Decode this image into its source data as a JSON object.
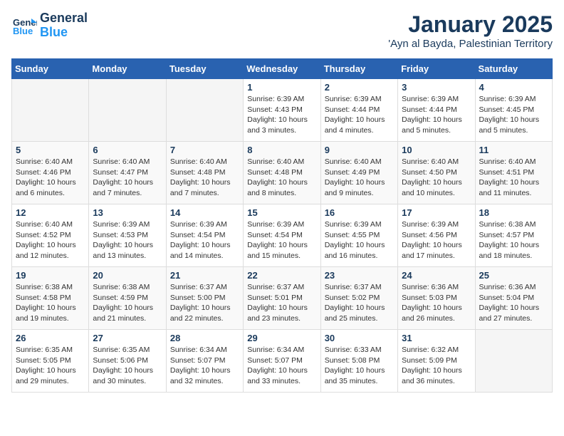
{
  "header": {
    "logo_line1": "General",
    "logo_line2": "Blue",
    "month_title": "January 2025",
    "location": "'Ayn al Bayda, Palestinian Territory"
  },
  "weekdays": [
    "Sunday",
    "Monday",
    "Tuesday",
    "Wednesday",
    "Thursday",
    "Friday",
    "Saturday"
  ],
  "weeks": [
    [
      {
        "day": "",
        "info": ""
      },
      {
        "day": "",
        "info": ""
      },
      {
        "day": "",
        "info": ""
      },
      {
        "day": "1",
        "info": "Sunrise: 6:39 AM\nSunset: 4:43 PM\nDaylight: 10 hours and 3 minutes."
      },
      {
        "day": "2",
        "info": "Sunrise: 6:39 AM\nSunset: 4:44 PM\nDaylight: 10 hours and 4 minutes."
      },
      {
        "day": "3",
        "info": "Sunrise: 6:39 AM\nSunset: 4:44 PM\nDaylight: 10 hours and 5 minutes."
      },
      {
        "day": "4",
        "info": "Sunrise: 6:39 AM\nSunset: 4:45 PM\nDaylight: 10 hours and 5 minutes."
      }
    ],
    [
      {
        "day": "5",
        "info": "Sunrise: 6:40 AM\nSunset: 4:46 PM\nDaylight: 10 hours and 6 minutes."
      },
      {
        "day": "6",
        "info": "Sunrise: 6:40 AM\nSunset: 4:47 PM\nDaylight: 10 hours and 7 minutes."
      },
      {
        "day": "7",
        "info": "Sunrise: 6:40 AM\nSunset: 4:48 PM\nDaylight: 10 hours and 7 minutes."
      },
      {
        "day": "8",
        "info": "Sunrise: 6:40 AM\nSunset: 4:48 PM\nDaylight: 10 hours and 8 minutes."
      },
      {
        "day": "9",
        "info": "Sunrise: 6:40 AM\nSunset: 4:49 PM\nDaylight: 10 hours and 9 minutes."
      },
      {
        "day": "10",
        "info": "Sunrise: 6:40 AM\nSunset: 4:50 PM\nDaylight: 10 hours and 10 minutes."
      },
      {
        "day": "11",
        "info": "Sunrise: 6:40 AM\nSunset: 4:51 PM\nDaylight: 10 hours and 11 minutes."
      }
    ],
    [
      {
        "day": "12",
        "info": "Sunrise: 6:40 AM\nSunset: 4:52 PM\nDaylight: 10 hours and 12 minutes."
      },
      {
        "day": "13",
        "info": "Sunrise: 6:39 AM\nSunset: 4:53 PM\nDaylight: 10 hours and 13 minutes."
      },
      {
        "day": "14",
        "info": "Sunrise: 6:39 AM\nSunset: 4:54 PM\nDaylight: 10 hours and 14 minutes."
      },
      {
        "day": "15",
        "info": "Sunrise: 6:39 AM\nSunset: 4:54 PM\nDaylight: 10 hours and 15 minutes."
      },
      {
        "day": "16",
        "info": "Sunrise: 6:39 AM\nSunset: 4:55 PM\nDaylight: 10 hours and 16 minutes."
      },
      {
        "day": "17",
        "info": "Sunrise: 6:39 AM\nSunset: 4:56 PM\nDaylight: 10 hours and 17 minutes."
      },
      {
        "day": "18",
        "info": "Sunrise: 6:38 AM\nSunset: 4:57 PM\nDaylight: 10 hours and 18 minutes."
      }
    ],
    [
      {
        "day": "19",
        "info": "Sunrise: 6:38 AM\nSunset: 4:58 PM\nDaylight: 10 hours and 19 minutes."
      },
      {
        "day": "20",
        "info": "Sunrise: 6:38 AM\nSunset: 4:59 PM\nDaylight: 10 hours and 21 minutes."
      },
      {
        "day": "21",
        "info": "Sunrise: 6:37 AM\nSunset: 5:00 PM\nDaylight: 10 hours and 22 minutes."
      },
      {
        "day": "22",
        "info": "Sunrise: 6:37 AM\nSunset: 5:01 PM\nDaylight: 10 hours and 23 minutes."
      },
      {
        "day": "23",
        "info": "Sunrise: 6:37 AM\nSunset: 5:02 PM\nDaylight: 10 hours and 25 minutes."
      },
      {
        "day": "24",
        "info": "Sunrise: 6:36 AM\nSunset: 5:03 PM\nDaylight: 10 hours and 26 minutes."
      },
      {
        "day": "25",
        "info": "Sunrise: 6:36 AM\nSunset: 5:04 PM\nDaylight: 10 hours and 27 minutes."
      }
    ],
    [
      {
        "day": "26",
        "info": "Sunrise: 6:35 AM\nSunset: 5:05 PM\nDaylight: 10 hours and 29 minutes."
      },
      {
        "day": "27",
        "info": "Sunrise: 6:35 AM\nSunset: 5:06 PM\nDaylight: 10 hours and 30 minutes."
      },
      {
        "day": "28",
        "info": "Sunrise: 6:34 AM\nSunset: 5:07 PM\nDaylight: 10 hours and 32 minutes."
      },
      {
        "day": "29",
        "info": "Sunrise: 6:34 AM\nSunset: 5:07 PM\nDaylight: 10 hours and 33 minutes."
      },
      {
        "day": "30",
        "info": "Sunrise: 6:33 AM\nSunset: 5:08 PM\nDaylight: 10 hours and 35 minutes."
      },
      {
        "day": "31",
        "info": "Sunrise: 6:32 AM\nSunset: 5:09 PM\nDaylight: 10 hours and 36 minutes."
      },
      {
        "day": "",
        "info": ""
      }
    ]
  ]
}
